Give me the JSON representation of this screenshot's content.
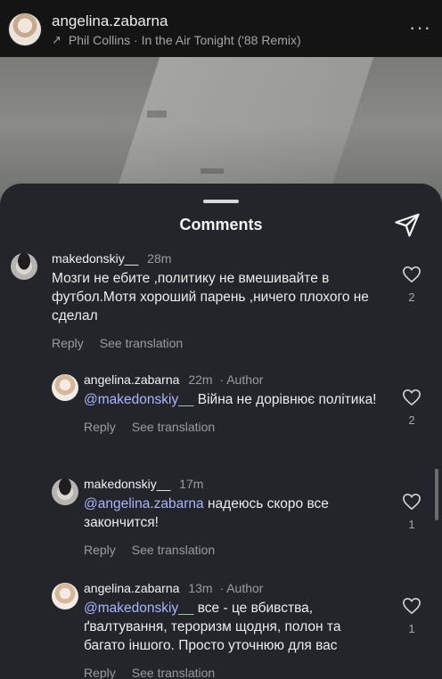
{
  "header": {
    "username": "angelina.zabarna",
    "music": "Phil Collins · In the Air Tonight ('88 Remix)"
  },
  "comments_panel": {
    "title": "Comments"
  },
  "comments": [
    {
      "username": "makedonskiy__",
      "time": "28m",
      "author_tag": "",
      "mention": "",
      "text": "Мозги не ебите ,политику не вмешивайте в футбол.Мотя хороший парень ,ничего плохого не сделал",
      "likes": "2",
      "reply": "Reply",
      "see_translation": "See translation"
    },
    {
      "username": "angelina.zabarna",
      "time": "22m",
      "author_tag": "· Author",
      "mention": "@makedonskiy__",
      "text": "Війна не дорівнює політика!",
      "likes": "2",
      "reply": "Reply",
      "see_translation": "See translation"
    },
    {
      "username": "makedonskiy__",
      "time": "17m",
      "author_tag": "",
      "mention": "@angelina.zabarna",
      "text": "надеюсь скоро все закончится!",
      "likes": "1",
      "reply": "Reply",
      "see_translation": "See translation"
    },
    {
      "username": "angelina.zabarna",
      "time": "13m",
      "author_tag": "· Author",
      "mention": "@makedonskiy__",
      "text": "все - це вбивства, ґвалтування, тероризм щодня, полон та багато іншого. Просто уточнюю для вас",
      "likes": "1",
      "reply": "Reply",
      "see_translation": "See translation"
    }
  ],
  "icons": {
    "music": "arrow-music-icon",
    "more": "more-icon",
    "share": "paper-plane-icon",
    "like": "heart-icon"
  },
  "colors": {
    "sheet_bg": "#24252a",
    "mention": "#a7b6ff",
    "muted_text": "#9c9c9f"
  }
}
